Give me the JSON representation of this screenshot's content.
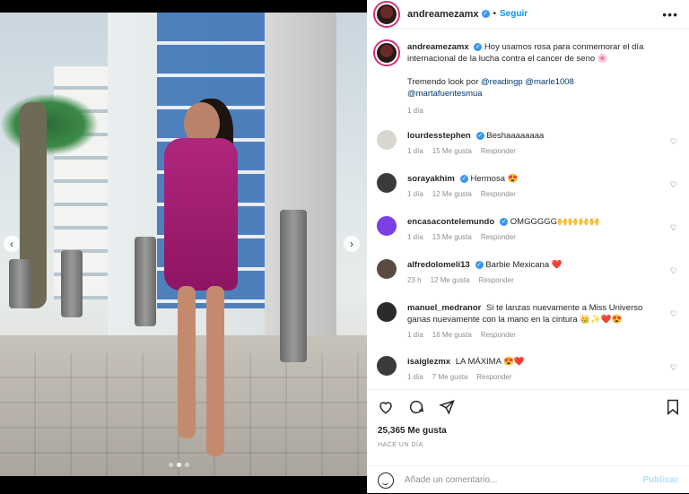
{
  "header": {
    "username": "andreamezamx",
    "separator": "•",
    "follow_label": "Seguir",
    "more_icon": "more-horizontal-icon"
  },
  "caption": {
    "username": "andreamezamx",
    "text": "Hoy usamos rosa para conmemorar el día internacional de la lucha contra el cancer de seno 🌸",
    "line2_prefix": "Tremendo look por ",
    "mentions": [
      "@readingp",
      "@marle1008",
      "@martafuentesmua"
    ],
    "time": "1 día"
  },
  "comments": [
    {
      "username": "lourdesstephen",
      "verified": true,
      "text": "Beshaaaaaaaa",
      "time": "1 día",
      "likes": "15 Me gusta",
      "reply": "Responder",
      "avatar_color": "#d9d5cf"
    },
    {
      "username": "sorayakhim",
      "verified": true,
      "text": "Hermosa 😍",
      "time": "1 día",
      "likes": "12 Me gusta",
      "reply": "Responder",
      "avatar_color": "#3a3a3a"
    },
    {
      "username": "encasacontelemundo",
      "verified": true,
      "text": "OMGGGGG🙌🙌🙌🙌",
      "time": "1 día",
      "likes": "13 Me gusta",
      "reply": "Responder",
      "avatar_color": "#7b3fe4"
    },
    {
      "username": "alfredolomeli13",
      "verified": true,
      "text": "Barbie Mexicana ❤️",
      "time": "23 h",
      "likes": "12 Me gusta",
      "reply": "Responder",
      "avatar_color": "#5a4a42"
    },
    {
      "username": "manuel_medranor",
      "verified": false,
      "text": "Si te lanzas nuevamente a Miss Universo ganas nuevamente con la mano en la cintura 👑✨❤️😍",
      "time": "1 día",
      "likes": "16 Me gusta",
      "reply": "Responder",
      "avatar_color": "#2b2b2b"
    },
    {
      "username": "isaiglezmx",
      "verified": false,
      "text": "LA MÁXIMA 😍❤️",
      "time": "1 día",
      "likes": "7 Me gusta",
      "reply": "Responder",
      "avatar_color": "#3b3b3b"
    }
  ],
  "actions": {
    "like_icon": "heart-icon",
    "comment_icon": "comment-icon",
    "share_icon": "send-icon",
    "save_icon": "bookmark-icon",
    "likes_count": "25,365 Me gusta",
    "posted_ago": "HACE UN DÍA"
  },
  "add_comment": {
    "placeholder": "Añade un comentario...",
    "publish_label": "Publicar",
    "emoji_icon": "emoji-icon"
  },
  "carousel": {
    "total": 3,
    "active": 2,
    "next_icon": "chevron-right-icon",
    "prev_icon": "chevron-left-icon"
  },
  "colors": {
    "link": "#0095f6",
    "verified": "#3897f0",
    "dress": "#a41f74"
  }
}
